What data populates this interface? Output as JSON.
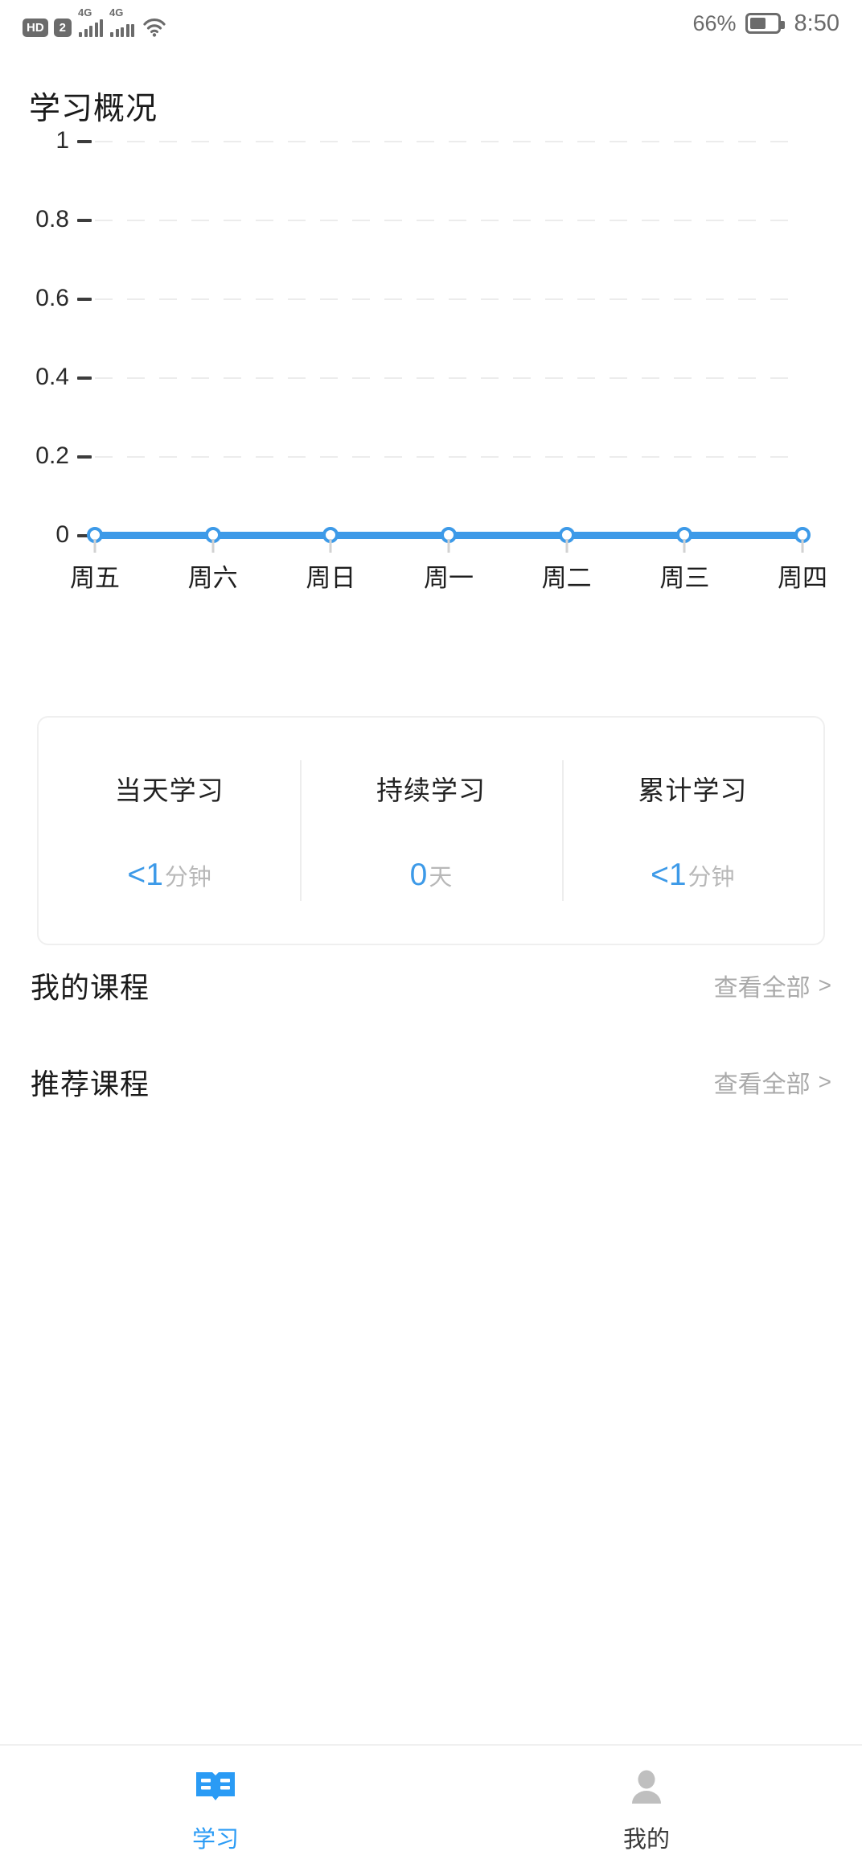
{
  "status_bar": {
    "hd_badge": "HD",
    "sim_badge": "2",
    "network_1": "4G",
    "network_2": "4G",
    "wifi_icon": "wifi-icon",
    "battery_percent": "66%",
    "time": "8:50"
  },
  "header": {
    "title": "学习概况"
  },
  "chart_data": {
    "type": "line",
    "title": "学习概况",
    "categories": [
      "周五",
      "周六",
      "周日",
      "周一",
      "周二",
      "周三",
      "周四"
    ],
    "values": [
      0,
      0,
      0,
      0,
      0,
      0,
      0
    ],
    "y_ticks": [
      "1",
      "0.8",
      "0.6",
      "0.4",
      "0.2",
      "0"
    ],
    "y_tick_values": [
      1,
      0.8,
      0.6,
      0.4,
      0.2,
      0
    ],
    "ylim": [
      0,
      1
    ],
    "xlabel": "",
    "ylabel": "",
    "grid": true,
    "grid_style": "dashed-horizontal",
    "legend": "none",
    "line_color": "#3d9ae8",
    "marker": "circle-open"
  },
  "stats": {
    "items": [
      {
        "label": "当天学习",
        "value": "<1",
        "unit": "分钟"
      },
      {
        "label": "持续学习",
        "value": "0",
        "unit": "天"
      },
      {
        "label": "累计学习",
        "value": "<1",
        "unit": "分钟"
      }
    ]
  },
  "sections": [
    {
      "title": "我的课程",
      "more": "查看全部",
      "chevron": ">"
    },
    {
      "title": "推荐课程",
      "more": "查看全部",
      "chevron": ">"
    }
  ],
  "tabbar": {
    "items": [
      {
        "label": "学习",
        "icon": "open-book-icon",
        "active": true
      },
      {
        "label": "我的",
        "icon": "person-icon",
        "active": false
      }
    ]
  },
  "colors": {
    "accent": "#3d9ae8",
    "tab_active": "#2a9bf5",
    "muted": "#a9a9a9",
    "grid": "#ececec"
  }
}
